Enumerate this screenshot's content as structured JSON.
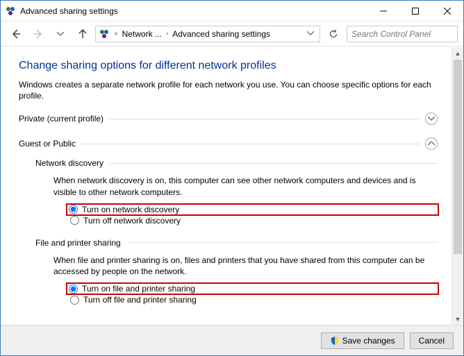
{
  "window": {
    "title": "Advanced sharing settings"
  },
  "breadcrumb": {
    "items": [
      "Network ...",
      "Advanced sharing settings"
    ]
  },
  "search": {
    "placeholder": "Search Control Panel"
  },
  "page": {
    "title": "Change sharing options for different network profiles",
    "description": "Windows creates a separate network profile for each network you use. You can choose specific options for each profile."
  },
  "profiles": {
    "private": {
      "label": "Private (current profile)",
      "expanded": false
    },
    "guest": {
      "label": "Guest or Public",
      "expanded": true
    }
  },
  "guest": {
    "network_discovery": {
      "heading": "Network discovery",
      "desc": "When network discovery is on, this computer can see other network computers and devices and is visible to other network computers.",
      "on_label": "Turn on network discovery",
      "off_label": "Turn off network discovery",
      "selected": "on"
    },
    "file_printer": {
      "heading": "File and printer sharing",
      "desc": "When file and printer sharing is on, files and printers that you have shared from this computer can be accessed by people on the network.",
      "on_label": "Turn on file and printer sharing",
      "off_label": "Turn off file and printer sharing",
      "selected": "on"
    }
  },
  "footer": {
    "save_label": "Save changes",
    "cancel_label": "Cancel"
  }
}
